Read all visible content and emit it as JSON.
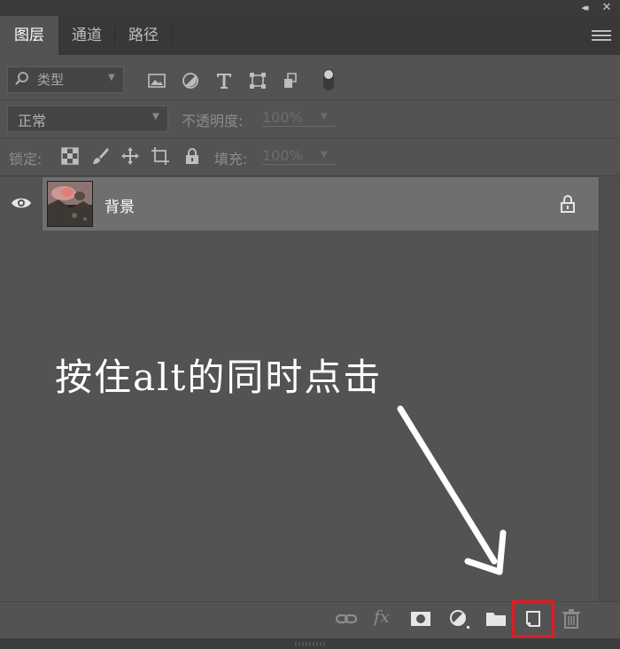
{
  "window": {
    "collapse_label": "◂◂",
    "close_label": "✕"
  },
  "tabs": [
    {
      "label": "图层",
      "active": true
    },
    {
      "label": "通道",
      "active": false
    },
    {
      "label": "路径",
      "active": false
    }
  ],
  "filter": {
    "kind_label": "类型",
    "icons": [
      "image-filter-icon",
      "adjustment-filter-icon",
      "text-filter-icon",
      "shape-filter-icon",
      "smart-object-filter-icon",
      "filter-toggle-icon"
    ]
  },
  "blend": {
    "mode": "正常",
    "opacity_label": "不透明度:",
    "opacity_value": "100%"
  },
  "lock": {
    "label": "锁定:",
    "icons": [
      "lock-transparent-pixels-icon",
      "lock-image-pixels-icon",
      "lock-position-icon",
      "lock-artboard-icon",
      "lock-all-icon"
    ],
    "fill_label": "填充:",
    "fill_value": "100%"
  },
  "layers": [
    {
      "name": "背景",
      "visible": true,
      "locked": true
    }
  ],
  "annotation": {
    "text": "按住alt的同时点击"
  },
  "toolbar": {
    "icons": [
      "link-layers-icon",
      "fx-icon",
      "add-mask-icon",
      "adjustment-layer-icon",
      "group-folder-icon",
      "new-layer-icon",
      "trash-icon"
    ],
    "fx_label": "fx",
    "highlight_color": "#e01b24"
  },
  "colors": {
    "panel_bg": "#535353",
    "tab_bar_bg": "#383838",
    "selected_layer_bg": "#6f6f6f",
    "text": "#cfcfcf"
  }
}
